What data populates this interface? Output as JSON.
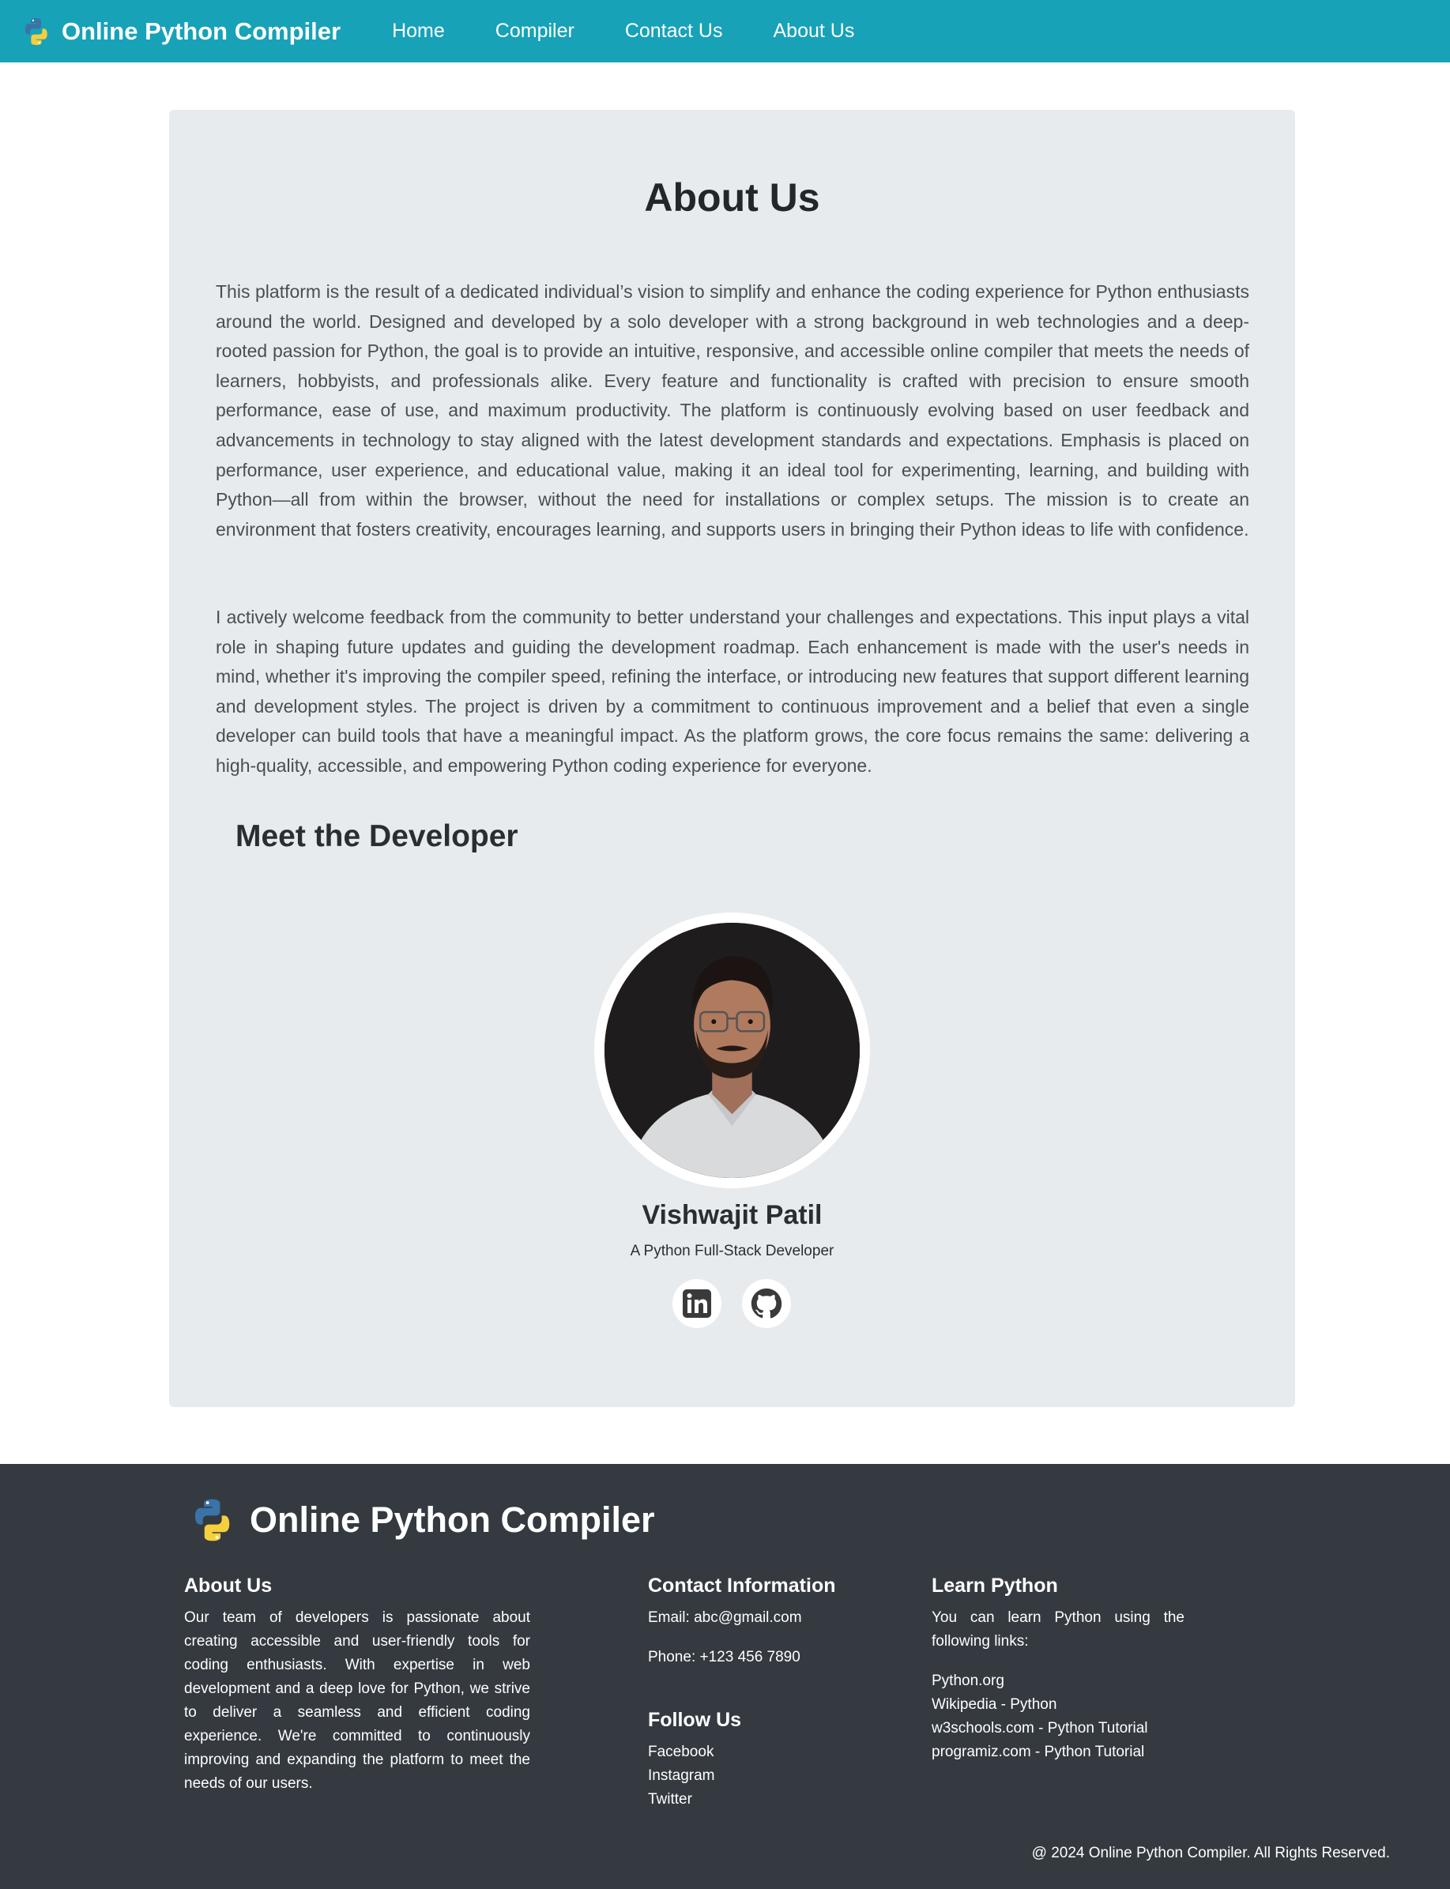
{
  "navbar": {
    "brand": "Online Python Compiler",
    "links": [
      "Home",
      "Compiler",
      "Contact Us",
      "About Us"
    ]
  },
  "about": {
    "title": "About Us",
    "paragraph_1": "This platform is the result of a dedicated individual’s vision to simplify and enhance the coding experience for Python enthusiasts around the world. Designed and developed by a solo developer with a strong background in web technologies and a deep-rooted passion for Python, the goal is to provide an intuitive, responsive, and accessible online compiler that meets the needs of learners, hobbyists, and professionals alike. Every feature and functionality is crafted with precision to ensure smooth performance, ease of use, and maximum productivity. The platform is continuously evolving based on user feedback and advancements in technology to stay aligned with the latest development standards and expectations. Emphasis is placed on performance, user experience, and educational value, making it an ideal tool for experimenting, learning, and building with Python—all from within the browser, without the need for installations or complex setups. The mission is to create an environment that fosters creativity, encourages learning, and supports users in bringing their Python ideas to life with confidence.",
    "paragraph_2": "I actively welcome feedback from the community to better understand your challenges and expectations. This input plays a vital role in shaping future updates and guiding the development roadmap. Each enhancement is made with the user's needs in mind, whether it's improving the compiler speed, refining the interface, or introducing new features that support different learning and development styles. The project is driven by a commitment to continuous improvement and a belief that even a single developer can build tools that have a meaningful impact. As the platform grows, the core focus remains the same: delivering a high-quality, accessible, and empowering Python coding experience for everyone.",
    "section_title": "Meet the Developer"
  },
  "developer": {
    "name": "Vishwajit Patil",
    "role": "A Python Full-Stack Developer",
    "socials": [
      "linkedin-icon",
      "github-icon"
    ]
  },
  "footer": {
    "brand": "Online Python Compiler",
    "about_heading": "About Us",
    "about_text": "Our team of developers is passionate about creating accessible and user-friendly tools for coding enthusiasts. With expertise in web development and a deep love for Python, we strive to deliver a seamless and efficient coding experience. We're committed to continuously improving and expanding the platform to meet the needs of our users.",
    "contact_heading": "Contact Information",
    "email": "Email: abc@gmail.com",
    "phone": "Phone: +123 456 7890",
    "follow_heading": "Follow Us",
    "follow_links": [
      "Facebook",
      "Instagram",
      "Twitter"
    ],
    "learn_heading": "Learn Python",
    "learn_text": "You can learn Python using the following links:",
    "learn_links": [
      "Python.org",
      "Wikipedia - Python",
      "w3schools.com - Python Tutorial",
      "programiz.com - Python Tutorial"
    ],
    "copyright": "@ 2024 Online Python Compiler. All Rights Reserved."
  },
  "colors": {
    "navbar": "#17a2b8",
    "card": "#e8ebee",
    "footer": "#343a40"
  }
}
